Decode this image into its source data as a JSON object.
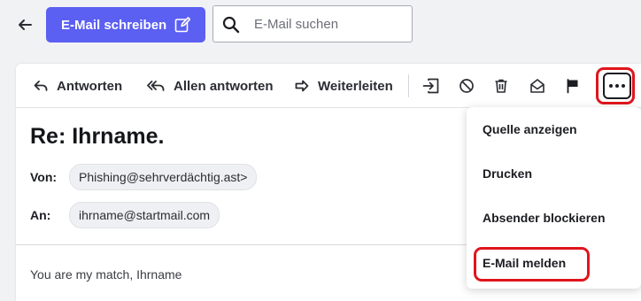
{
  "topbar": {
    "compose_label": "E-Mail schreiben",
    "search_placeholder": "E-Mail suchen"
  },
  "toolbar": {
    "reply_label": "Antworten",
    "reply_all_label": "Allen antworten",
    "forward_label": "Weiterleiten",
    "icons": [
      "move-to-icon",
      "block-icon",
      "trash-icon",
      "mark-unread-icon",
      "flag-icon",
      "more-icon"
    ]
  },
  "message": {
    "subject": "Re: Ihrname.",
    "from_label": "Von:",
    "from_value": "Phishing@sehrverdächtig.ast>",
    "to_label": "An:",
    "to_value": "ihrname@startmail.com",
    "body": "You are my match, Ihrname"
  },
  "more_menu": {
    "items": [
      {
        "label": "Quelle anzeigen"
      },
      {
        "label": "Drucken"
      },
      {
        "label": "Absender blockieren"
      },
      {
        "label": "E-Mail melden",
        "highlighted": true
      }
    ]
  },
  "colors": {
    "accent": "#5b5ff2",
    "highlight": "#e0151c",
    "background": "#f1f2f4"
  }
}
